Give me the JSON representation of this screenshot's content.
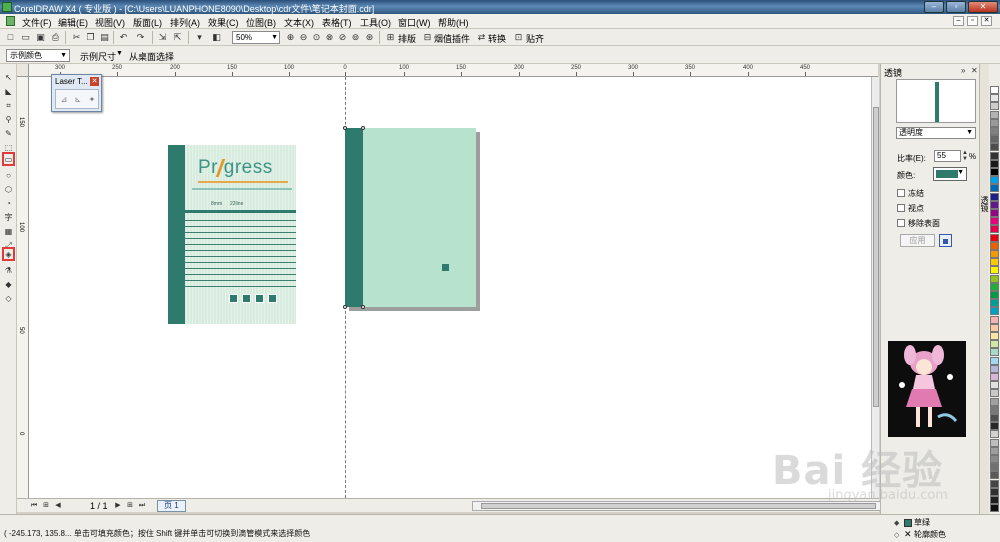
{
  "window": {
    "title": "CorelDRAW X4 ( 专业版 ) - [C:\\Users\\LUANPHONE8090\\Desktop\\cdr文件\\笔记本封面.cdr]"
  },
  "menubar": {
    "items": [
      "文件(F)",
      "编辑(E)",
      "视图(V)",
      "版面(L)",
      "排列(A)",
      "效果(C)",
      "位图(B)",
      "文本(X)",
      "表格(T)",
      "工具(O)",
      "窗口(W)",
      "帮助(H)"
    ]
  },
  "toolbar": {
    "zoom": "50%",
    "plugins": [
      "排版",
      "烟值插件",
      "转换",
      "贴齐"
    ]
  },
  "propertybar": {
    "color_select": "示例颜色",
    "size_label": "示例尺寸",
    "desktop_select": "从桌面选择"
  },
  "ruler": {
    "h_labels": [
      "300",
      "250",
      "200",
      "150",
      "100",
      "50",
      "0",
      "50",
      "100",
      "150",
      "200",
      "250",
      "300",
      "350",
      "400",
      "450"
    ],
    "v_labels": [
      "150",
      "100",
      "50",
      "0"
    ]
  },
  "laser_tool": {
    "title": "Laser T..."
  },
  "cover": {
    "brand": "Pr gress",
    "spec_left": "8mm",
    "spec_right": "22line"
  },
  "page_nav": {
    "count": "1 / 1",
    "tab": "页 1"
  },
  "docker": {
    "title": "透镜",
    "mode": "透明度",
    "rate_label": "比率(E):",
    "rate_value": "55",
    "rate_unit": "%",
    "color_label": "颜色:",
    "color": "#2e7a6c",
    "checkboxes": [
      "冻结",
      "视点",
      "移除表面"
    ],
    "apply": "应用",
    "side_tab": "透镜"
  },
  "status": {
    "hint": "( -245.173, 135.8... 单击可填充颜色；按住 Shift 键并单击可切换到滴管模式来选择颜色",
    "fill_label": "草绿",
    "outline_label": "轮廓颜色"
  },
  "watermark": {
    "main": "Bai 经验",
    "sub": "jingyan.baidu.com"
  },
  "palette": {
    "colors": [
      "#ffffff",
      "#e6e6e6",
      "#cccccc",
      "#b3b3b3",
      "#999999",
      "#808080",
      "#666666",
      "#4d4d4d",
      "#333333",
      "#1a1a1a",
      "#000000",
      "#00a0e9",
      "#0068b7",
      "#1d2088",
      "#601986",
      "#920783",
      "#e4007f",
      "#e5004f",
      "#e60012",
      "#eb6100",
      "#f39800",
      "#fcc800",
      "#fff100",
      "#8fc31f",
      "#22ac38",
      "#009944",
      "#009e96",
      "#00a0c1",
      "#f5b2b2",
      "#f8c9a5",
      "#fce4a3",
      "#d0e6a5",
      "#a8d8c8",
      "#a3d6f0",
      "#b5b5d9",
      "#d8b5d8",
      "#e0e0e0",
      "#c8c8c8",
      "#a0a0a0",
      "#787878",
      "#505050",
      "#282828",
      "#d1d1d1",
      "#bdbdbd",
      "#9e9e9e",
      "#8a8a8a",
      "#707070",
      "#5a5a5a",
      "#454545",
      "#303030",
      "#1f1f1f",
      "#111111"
    ]
  }
}
